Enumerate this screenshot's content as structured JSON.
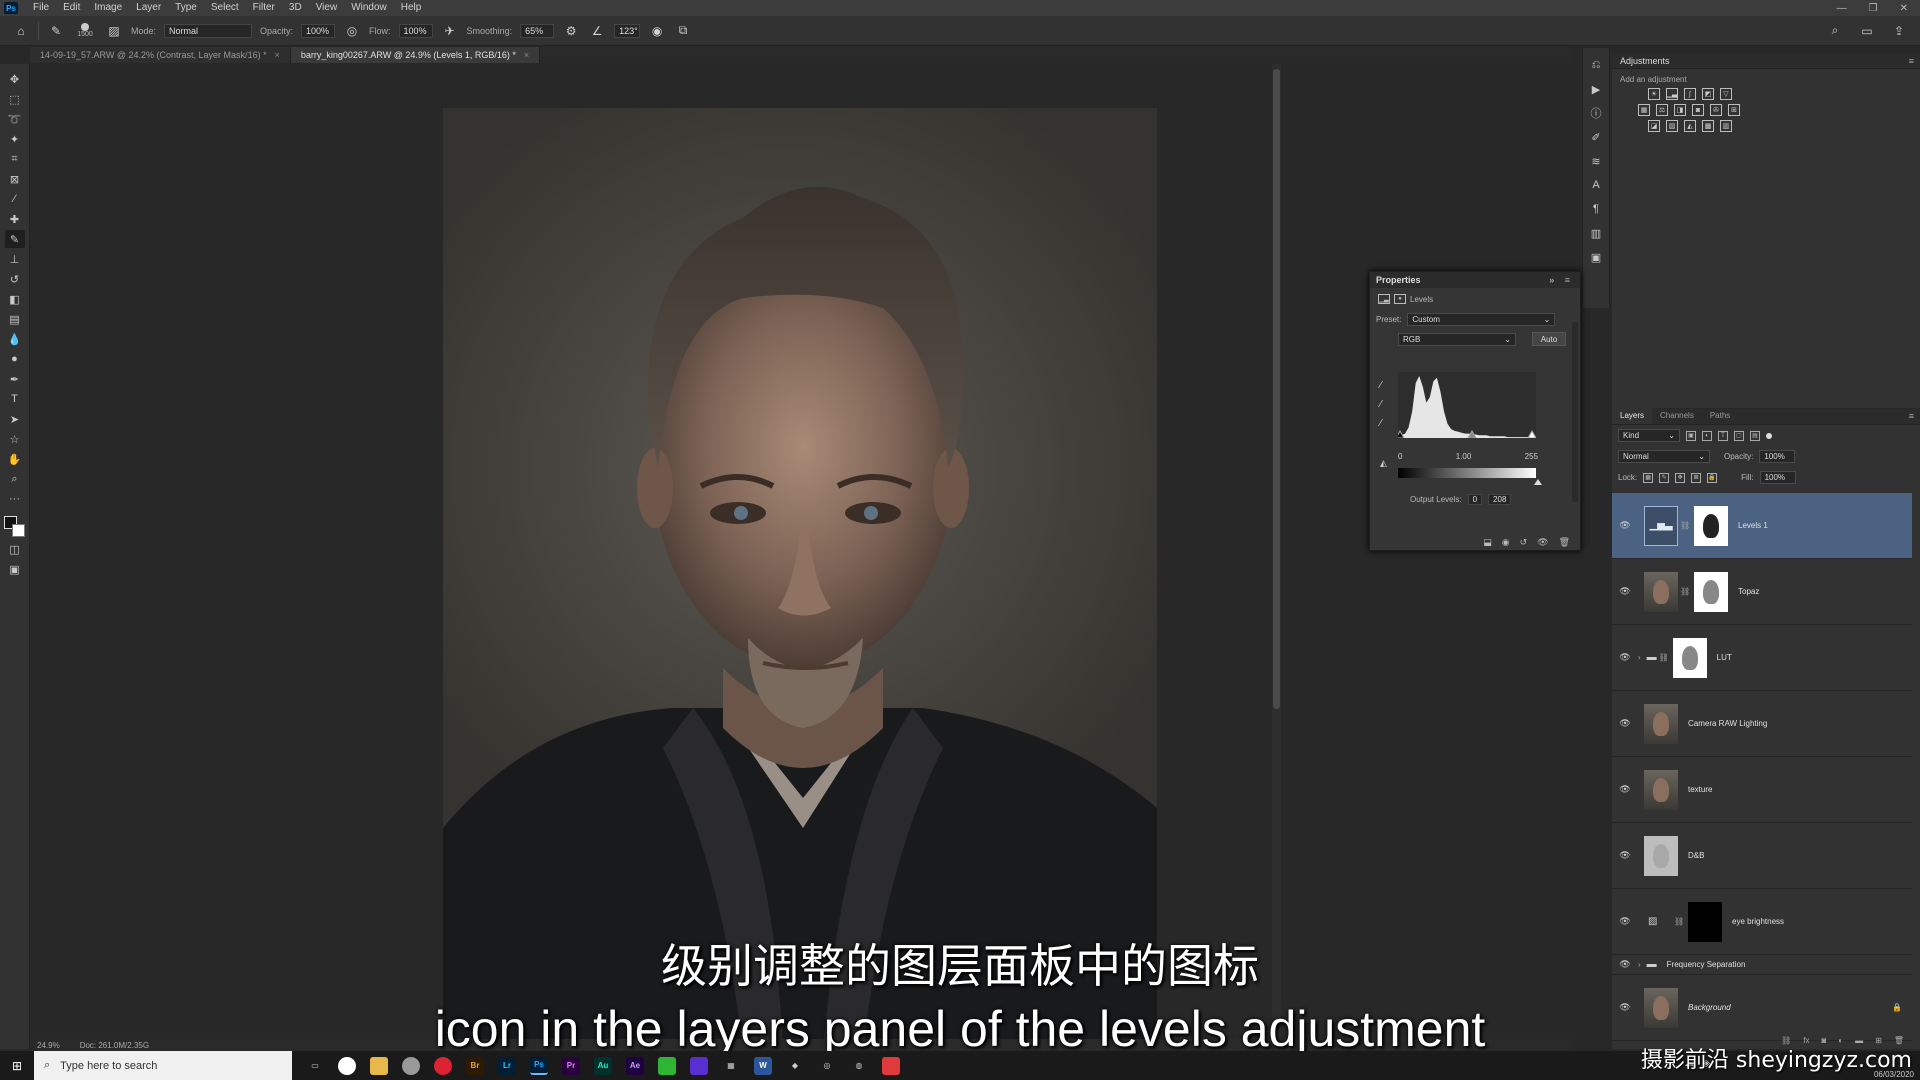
{
  "menu": [
    "File",
    "Edit",
    "Image",
    "Layer",
    "Type",
    "Select",
    "Filter",
    "3D",
    "View",
    "Window",
    "Help"
  ],
  "logo_text": "Ps",
  "window_controls": [
    "—",
    "❐",
    "✕"
  ],
  "options": {
    "brush_size": "1500",
    "mode_label": "Mode:",
    "mode_value": "Normal",
    "opacity_label": "Opacity:",
    "opacity_value": "100%",
    "flow_label": "Flow:",
    "flow_value": "100%",
    "smoothing_label": "Smoothing:",
    "smoothing_value": "65%",
    "angle_value": "123°"
  },
  "tabs": [
    {
      "label": "14-09-19_57.ARW @ 24.2% (Contrast, Layer Mask/16) *",
      "close": "×"
    },
    {
      "label": "barry_king00267.ARW @ 24.9% (Levels 1, RGB/16) *",
      "close": "×"
    }
  ],
  "status": {
    "zoom": "24.9%",
    "doc": "Doc: 261.0M/2.35G"
  },
  "subtitles": {
    "cn": "级别调整的图层面板中的图标",
    "en": "icon in the layers panel of the levels adjustment"
  },
  "adjustments": {
    "title": "Adjustments",
    "add_label": "Add an adjustment"
  },
  "properties": {
    "title": "Properties",
    "type_label": "Levels",
    "preset_label": "Preset:",
    "preset_value": "Custom",
    "channel_value": "RGB",
    "auto_label": "Auto",
    "input_black": "0",
    "input_gamma": "1.00",
    "input_white": "255",
    "output_label": "Output Levels:",
    "output_black": "0",
    "output_white": "208",
    "histogram": [
      2,
      3,
      5,
      12,
      30,
      62,
      70,
      58,
      40,
      46,
      64,
      68,
      52,
      30,
      16,
      10,
      8,
      7,
      6,
      5,
      5,
      4,
      4,
      3,
      3,
      3,
      2,
      2,
      2,
      2,
      2,
      1,
      1,
      1,
      1,
      1,
      1,
      1,
      0,
      0
    ]
  },
  "layers": {
    "tabs": [
      "Layers",
      "Channels",
      "Paths"
    ],
    "kind_label": "Kind",
    "blend_mode": "Normal",
    "opacity_label": "Opacity:",
    "opacity_value": "100%",
    "lock_label": "Lock:",
    "fill_label": "Fill:",
    "fill_value": "100%",
    "items": [
      {
        "name": "Levels 1"
      },
      {
        "name": "Topaz"
      },
      {
        "name": "LUT"
      },
      {
        "name": "Camera RAW Lighting"
      },
      {
        "name": "texture"
      },
      {
        "name": "D&B"
      },
      {
        "name": "eye brightness"
      },
      {
        "name": "Frequency Separation"
      },
      {
        "name": "Background"
      }
    ]
  },
  "taskbar": {
    "search_placeholder": "Type here to search",
    "apps": [
      "Br",
      "Lr",
      "Ps",
      "Pr",
      "Au",
      "Ae"
    ]
  },
  "watermark": "摄影前沿 sheyingzyz.com",
  "clock": "06/03/2020"
}
